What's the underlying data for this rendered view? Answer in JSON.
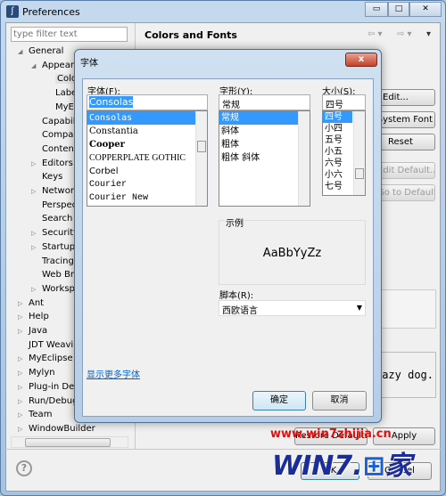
{
  "window": {
    "title": "Preferences",
    "minimize": "▭",
    "maximize": "□",
    "close": "✕"
  },
  "filter": {
    "placeholder": "type filter text"
  },
  "tree": [
    {
      "label": "General",
      "level": 0,
      "toggle": "open"
    },
    {
      "label": "Appearance",
      "level": 1,
      "toggle": "open"
    },
    {
      "label": "Colors and Fonts",
      "level": 2,
      "toggle": "none",
      "selected": true
    },
    {
      "label": "Label Decorations",
      "level": 2,
      "toggle": "none"
    },
    {
      "label": "MyEclipse",
      "level": 2,
      "toggle": "none"
    },
    {
      "label": "Capabilities",
      "level": 1,
      "toggle": "none"
    },
    {
      "label": "Compare/Patch",
      "level": 1,
      "toggle": "none"
    },
    {
      "label": "Content Types",
      "level": 1,
      "toggle": "none"
    },
    {
      "label": "Editors",
      "level": 1,
      "toggle": "closed"
    },
    {
      "label": "Keys",
      "level": 1,
      "toggle": "none"
    },
    {
      "label": "Network Connections",
      "level": 1,
      "toggle": "closed"
    },
    {
      "label": "Perspectives",
      "level": 1,
      "toggle": "none"
    },
    {
      "label": "Search",
      "level": 1,
      "toggle": "none"
    },
    {
      "label": "Security",
      "level": 1,
      "toggle": "closed"
    },
    {
      "label": "Startup and Shutdown",
      "level": 1,
      "toggle": "closed"
    },
    {
      "label": "Tracing",
      "level": 1,
      "toggle": "none"
    },
    {
      "label": "Web Browser",
      "level": 1,
      "toggle": "none"
    },
    {
      "label": "Workspace",
      "level": 1,
      "toggle": "closed"
    },
    {
      "label": "Ant",
      "level": 0,
      "toggle": "closed"
    },
    {
      "label": "Help",
      "level": 0,
      "toggle": "closed"
    },
    {
      "label": "Java",
      "level": 0,
      "toggle": "closed"
    },
    {
      "label": "JDT Weaving",
      "level": 0,
      "toggle": "none"
    },
    {
      "label": "MyEclipse",
      "level": 0,
      "toggle": "closed"
    },
    {
      "label": "Mylyn",
      "level": 0,
      "toggle": "closed"
    },
    {
      "label": "Plug-in Development",
      "level": 0,
      "toggle": "closed"
    },
    {
      "label": "Run/Debug",
      "level": 0,
      "toggle": "closed"
    },
    {
      "label": "Team",
      "level": 0,
      "toggle": "closed"
    },
    {
      "label": "WindowBuilder",
      "level": 0,
      "toggle": "closed"
    }
  ],
  "right": {
    "title": "Colors and Fonts",
    "nav": {
      "back": "⇦ ▾",
      "forward": "⇨ ▾",
      "menu": "▾"
    },
    "buttons": {
      "edit": "Edit...",
      "system_font": "Use System Font",
      "reset": "Reset",
      "edit_default": "Edit Default...",
      "go_to_default": "Go to Default"
    },
    "preview_text": "The quick brown fox jumps over the lazy dog.",
    "restore_defaults": "Restore Defaults",
    "apply": "Apply"
  },
  "bottom": {
    "ok": "OK",
    "cancel": "Cancel",
    "help_icon": "question-mark"
  },
  "font_dialog": {
    "title": "字体",
    "close": "x",
    "font_label": "字体(F):",
    "font_value": "Consolas",
    "fonts": [
      "Consolas",
      "Constantia",
      "Cooper",
      "COPPERPLATE GOTHIC",
      "Corbel",
      "Courier",
      "Courier New"
    ],
    "style_label": "字形(Y):",
    "style_value": "常规",
    "styles": [
      "常规",
      "斜体",
      "粗体",
      "粗体 斜体"
    ],
    "size_label": "大小(S):",
    "size_value": "四号",
    "sizes": [
      "四号",
      "小四",
      "五号",
      "小五",
      "六号",
      "小六",
      "七号"
    ],
    "sample_label": "示例",
    "sample_text": "AaBbYyZz",
    "script_label": "脚本(R):",
    "script_value": "西欧语言",
    "more_fonts_link": "显示更多字体",
    "ok": "确定",
    "cancel": "取消"
  },
  "watermark": {
    "url": "www.win7zhijia.cn",
    "logo": "WIN7.家"
  }
}
